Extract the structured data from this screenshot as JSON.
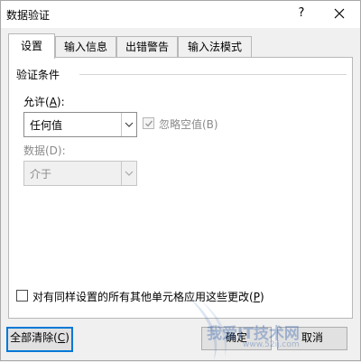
{
  "window": {
    "title": "数据验证",
    "help": "?"
  },
  "tabs": [
    {
      "label": "设置",
      "active": true
    },
    {
      "label": "输入信息",
      "active": false
    },
    {
      "label": "出错警告",
      "active": false
    },
    {
      "label": "输入法模式",
      "active": false
    }
  ],
  "criteria": {
    "group_label": "验证条件",
    "allow_label": "允许(",
    "allow_key": "A",
    "allow_suffix": "):",
    "allow_value": "任何值",
    "ignore_blank_label": "忽略空值(B)",
    "ignore_blank_checked": true,
    "data_label": "数据(D):",
    "data_value": "介于"
  },
  "apply_all": {
    "label": "对有同样设置的所有其他单元格应用这些更改(",
    "key": "P",
    "suffix": ")",
    "checked": false
  },
  "buttons": {
    "clear_all": "全部清除(",
    "clear_all_key": "C",
    "clear_all_suffix": ")",
    "ok": "确定",
    "cancel": "取消"
  },
  "watermark": {
    "text": "我爱IT技术网",
    "url": "www.52ij.com"
  }
}
